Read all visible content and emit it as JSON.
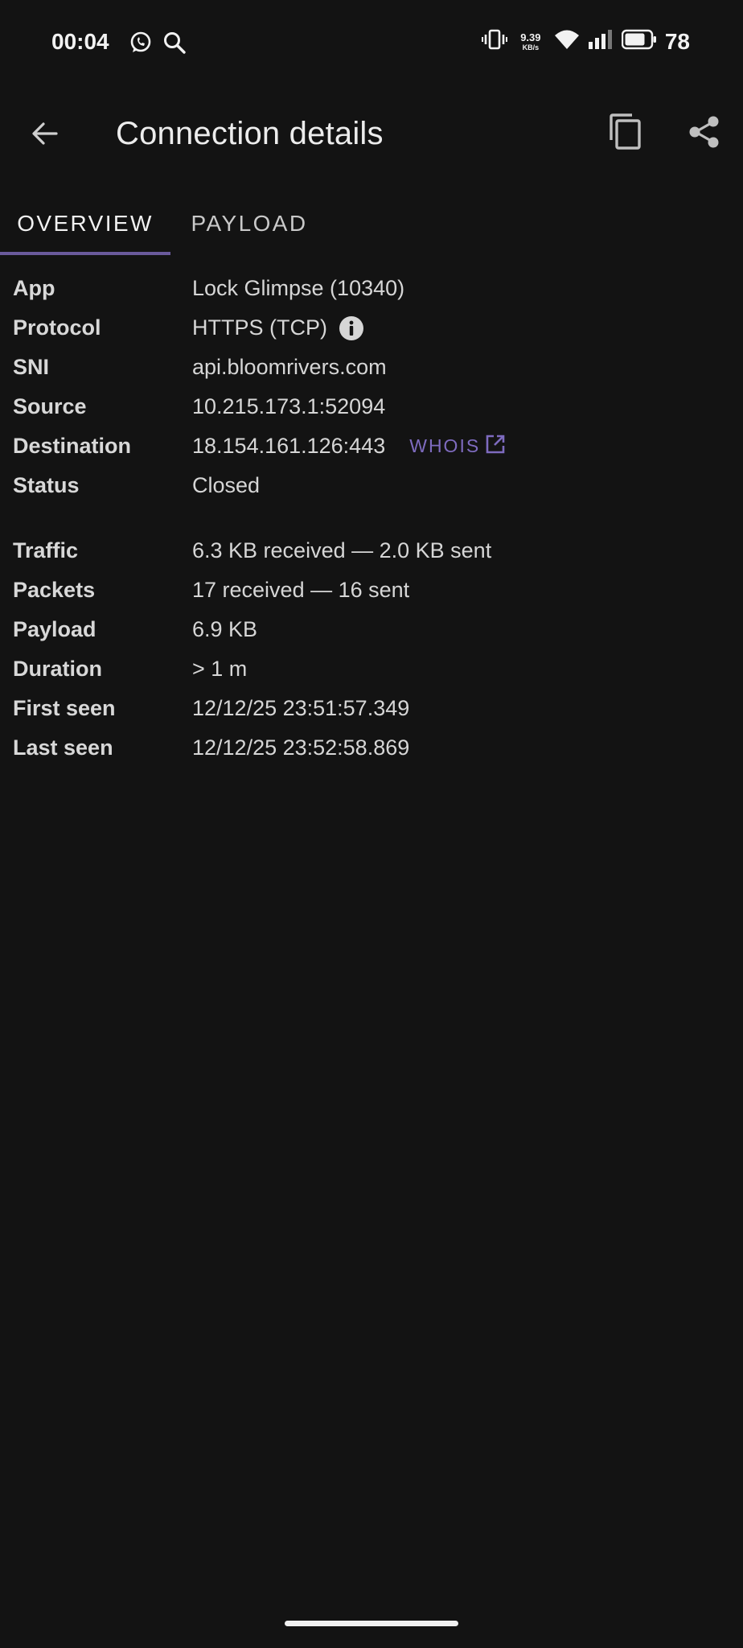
{
  "status_bar": {
    "time": "00:04",
    "net_speed_value": "9.39",
    "net_speed_unit": "KB/s",
    "battery": "78",
    "icons": [
      "whatsapp-icon",
      "search-icon",
      "vibrate-icon",
      "wifi-icon",
      "signal-icon",
      "battery-icon"
    ]
  },
  "toolbar": {
    "title": "Connection details",
    "icons": [
      "back-arrow-icon",
      "copy-icon",
      "share-icon"
    ]
  },
  "tabs": [
    {
      "label": "OVERVIEW",
      "selected": true
    },
    {
      "label": "PAYLOAD",
      "selected": false
    }
  ],
  "details": {
    "app": {
      "label": "App",
      "value": "Lock Glimpse (10340)"
    },
    "protocol": {
      "label": "Protocol",
      "value": "HTTPS (TCP)"
    },
    "sni": {
      "label": "SNI",
      "value": "api.bloomrivers.com"
    },
    "source": {
      "label": "Source",
      "value": "10.215.173.1:52094"
    },
    "destination": {
      "label": "Destination",
      "value": "18.154.161.126:443",
      "link": "WHOIS"
    },
    "status": {
      "label": "Status",
      "value": "Closed"
    },
    "traffic": {
      "label": "Traffic",
      "value": "6.3 KB received — 2.0 KB sent"
    },
    "packets": {
      "label": "Packets",
      "value": "17 received — 16 sent"
    },
    "payload": {
      "label": "Payload",
      "value": "6.9 KB"
    },
    "duration": {
      "label": "Duration",
      "value": "> 1 m"
    },
    "first_seen": {
      "label": "First seen",
      "value": "12/12/25 23:51:57.349"
    },
    "last_seen": {
      "label": "Last seen",
      "value": "12/12/25 23:52:58.869"
    }
  },
  "colors": {
    "background": "#131313",
    "accent": "#7e6bbf",
    "tab_indicator": "#6a5a9c",
    "text": "#d6d6d6"
  }
}
